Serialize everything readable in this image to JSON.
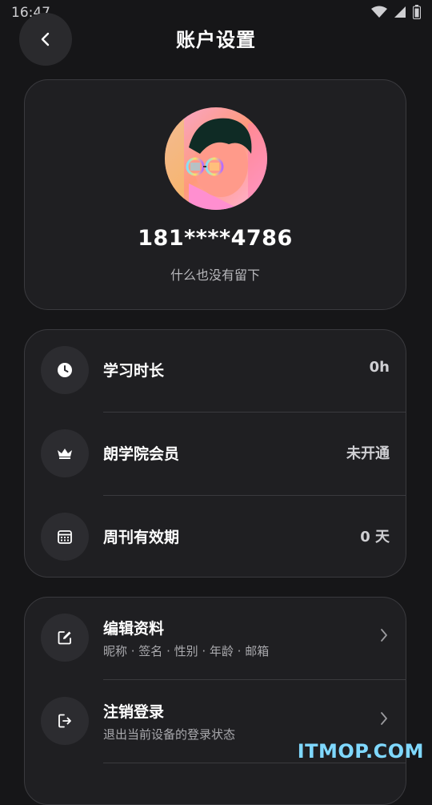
{
  "status_bar": {
    "time": "16:47"
  },
  "header": {
    "title": "账户设置"
  },
  "profile": {
    "phone": "181****4786",
    "bio": "什么也没有留下"
  },
  "stats": [
    {
      "label": "学习时长",
      "value": "0h",
      "icon": "clock-icon"
    },
    {
      "label": "朗学院会员",
      "value": "未开通",
      "icon": "crown-icon"
    },
    {
      "label": "周刊有效期",
      "value": "0 天",
      "icon": "calendar-icon"
    }
  ],
  "menu": [
    {
      "label": "编辑资料",
      "sub": "昵称 · 签名 · 性别 · 年龄 · 邮箱",
      "icon": "edit-icon"
    },
    {
      "label": "注销登录",
      "sub": "退出当前设备的登录状态",
      "icon": "logout-icon"
    }
  ],
  "watermark": "ITMOP.COM",
  "colors": {
    "background": "#161618",
    "card": "#1f1f22",
    "watermark": "#7fd8ff"
  }
}
